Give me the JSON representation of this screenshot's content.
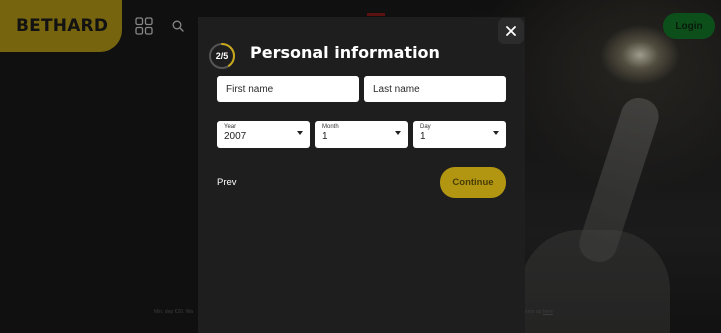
{
  "brand": {
    "logo_text": "BETHARD",
    "accent_color": "#b59a17"
  },
  "header": {
    "grid_icon": "grid-icon",
    "search_icon": "search-icon",
    "login_label": "Login",
    "login_color": "#157a29"
  },
  "modal": {
    "step_indicator": "2/5",
    "step_progress": 0.4,
    "title": "Personal information",
    "close_icon": "close-icon",
    "first_name_placeholder": "First name",
    "last_name_placeholder": "Last name",
    "first_name_value": "",
    "last_name_value": "",
    "year": {
      "label": "Year",
      "value": "2007"
    },
    "month": {
      "label": "Month",
      "value": "1"
    },
    "day": {
      "label": "Day",
      "value": "1"
    },
    "prev_label": "Prev",
    "continue_label": "Continue",
    "continue_color": "#b29612"
  },
  "footer": {
    "left_text": "Min. dep €20. Wa",
    "right_text": "terms ap",
    "right_link": "here"
  }
}
